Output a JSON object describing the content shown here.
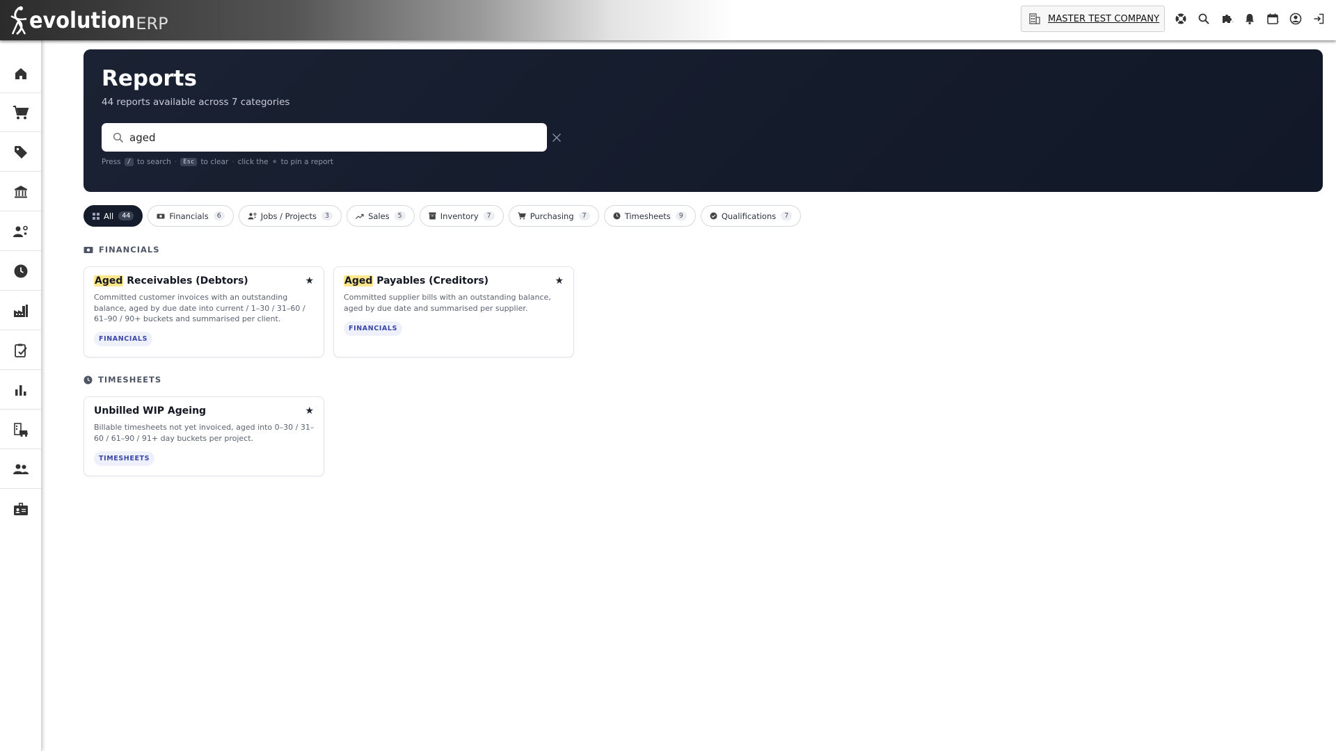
{
  "app": {
    "logo_text": "evolution",
    "logo_suffix": "ERP",
    "company": "MASTER TEST COMPANY"
  },
  "top_icons": [
    "help-lifebuoy-icon",
    "search-icon",
    "puzzle-icon",
    "bell-icon",
    "calendar-icon",
    "user-circle-icon",
    "logout-icon"
  ],
  "sidebar": [
    "home-icon",
    "cart-icon",
    "tag-icon",
    "bank-icon",
    "user-settings-icon",
    "clock-icon",
    "factory-icon",
    "clipboard-check-icon",
    "bar-chart-icon",
    "fleet-icon",
    "people-icon",
    "id-card-icon"
  ],
  "hero": {
    "title": "Reports",
    "subtitle": "44 reports available across 7 categories",
    "search_value": "aged",
    "hint_press": "Press",
    "hint_slash": "/",
    "hint_to_search": "to search",
    "hint_esc": "Esc",
    "hint_to_clear": "to clear",
    "hint_click_the": "click the",
    "hint_pin": "to pin a report",
    "dot": "·"
  },
  "chips": [
    {
      "label": "All",
      "count": "44",
      "icon": "grid-icon",
      "active": true
    },
    {
      "label": "Financials",
      "count": "6",
      "icon": "cash-icon"
    },
    {
      "label": "Jobs / Projects",
      "count": "3",
      "icon": "user-gear-icon"
    },
    {
      "label": "Sales",
      "count": "5",
      "icon": "trend-icon"
    },
    {
      "label": "Inventory",
      "count": "7",
      "icon": "box-icon"
    },
    {
      "label": "Purchasing",
      "count": "7",
      "icon": "cart-icon"
    },
    {
      "label": "Timesheets",
      "count": "9",
      "icon": "clock-icon"
    },
    {
      "label": "Qualifications",
      "count": "7",
      "icon": "badge-icon"
    }
  ],
  "sections": {
    "financials": {
      "title": "FINANCIALS",
      "cards": [
        {
          "highlight": "Aged",
          "title_rest": " Receivables (Debtors)",
          "description": "Committed customer invoices with an outstanding balance, aged by due date into current / 1–30 / 31–60 / 61–90 / 90+ buckets and summarised per client.",
          "tag": "FINANCIALS",
          "star": "★"
        },
        {
          "highlight": "Aged",
          "title_rest": " Payables (Creditors)",
          "description": "Committed supplier bills with an outstanding balance, aged by due date and summarised per supplier.",
          "tag": "FINANCIALS",
          "star": "★"
        }
      ]
    },
    "timesheets": {
      "title": "TIMESHEETS",
      "cards": [
        {
          "title": "Unbilled WIP Ageing",
          "description": "Billable timesheets not yet invoiced, aged into 0–30 / 31–60 / 61–90 / 91+ day buckets per project.",
          "tag": "TIMESHEETS",
          "star": "★"
        }
      ]
    }
  },
  "colors": {
    "hero_bg": "#141b2b",
    "highlight": "#fde68a",
    "tag_bg": "#eef0fb",
    "tag_text": "#3a47a8"
  }
}
